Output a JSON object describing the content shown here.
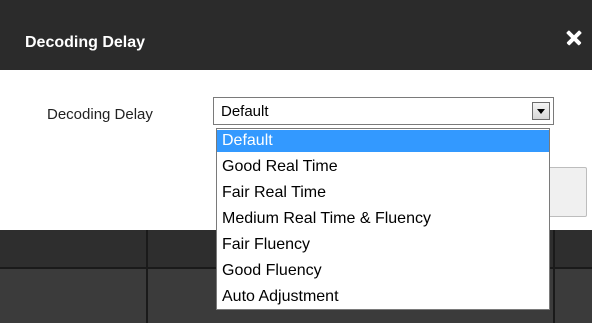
{
  "dialog": {
    "title": "Decoding Delay",
    "close_icon": "close-icon"
  },
  "form": {
    "label": "Decoding Delay",
    "select_value": "Default",
    "arrow_icon": "chevron-down-icon"
  },
  "dropdown": {
    "options": [
      "Default",
      "Good Real Time",
      "Fair Real Time",
      "Medium Real Time & Fluency",
      "Fair Fluency",
      "Good Fluency",
      "Auto Adjustment"
    ],
    "selected": "Default"
  },
  "colors": {
    "titlebar": "#2b2b2b",
    "highlight": "#3399ff",
    "grid_panel": "#3b3b3b"
  }
}
